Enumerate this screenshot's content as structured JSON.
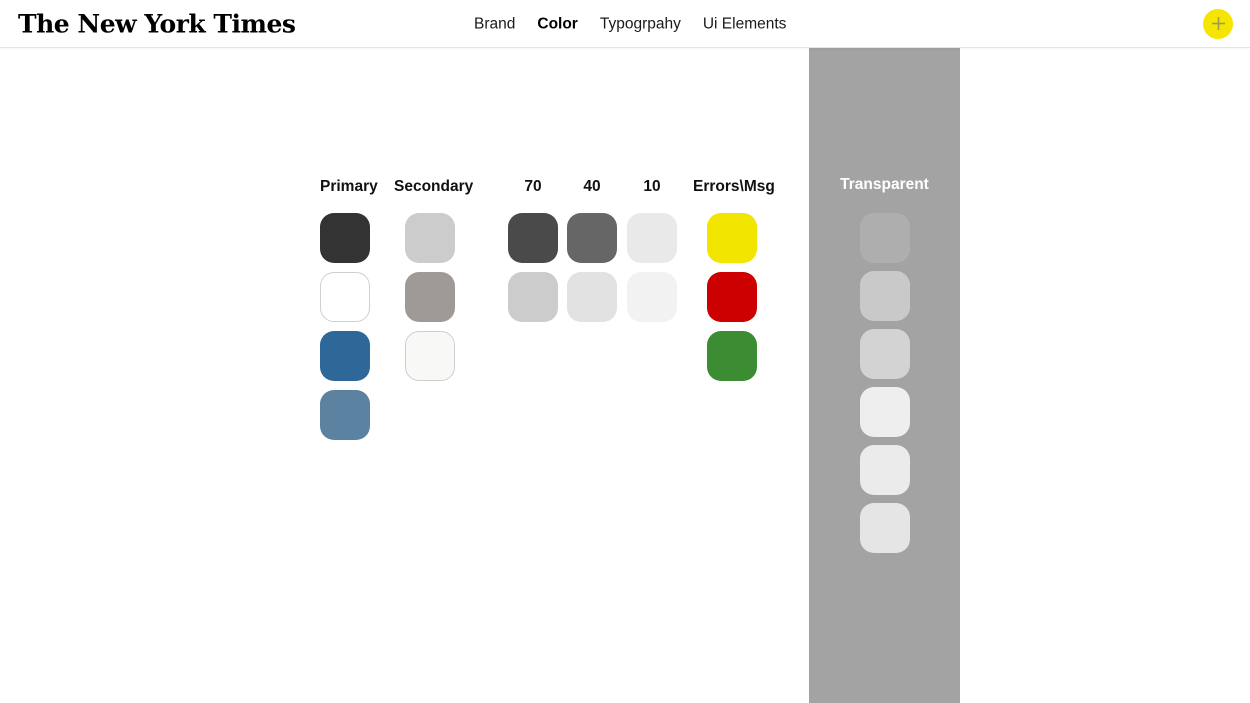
{
  "header": {
    "logo_text": "The New York Times",
    "nav": [
      {
        "label": "Brand",
        "active": false
      },
      {
        "label": "Color",
        "active": true
      },
      {
        "label": "Typogrpahy",
        "active": false
      },
      {
        "label": "Ui Elements",
        "active": false
      }
    ],
    "add_button": {
      "icon": "plus-icon",
      "background": "#f5e500",
      "icon_color": "#9b9b5a"
    }
  },
  "palette": {
    "columns": [
      {
        "header": "Primary",
        "swatches": [
          {
            "color": "#333333",
            "bordered": false
          },
          {
            "color": "#ffffff",
            "bordered": true
          },
          {
            "color": "#2d6898",
            "bordered": false
          },
          {
            "color": "#5b82a0",
            "bordered": false
          }
        ]
      },
      {
        "header": "Secondary",
        "swatches": [
          {
            "color": "#cccccc",
            "bordered": false
          },
          {
            "color": "#9e9a98",
            "bordered": false
          },
          {
            "color": "#f8f8f6",
            "bordered": true
          }
        ]
      },
      {
        "header": "70",
        "swatches": [
          {
            "color": "#4a4a4a",
            "bordered": false
          },
          {
            "color": "#cccccc",
            "bordered": false
          }
        ]
      },
      {
        "header": "40",
        "swatches": [
          {
            "color": "#666666",
            "bordered": false
          },
          {
            "color": "#e2e2e2",
            "bordered": false
          }
        ]
      },
      {
        "header": "10",
        "swatches": [
          {
            "color": "#e9e9e9",
            "bordered": false
          },
          {
            "color": "#f2f2f2",
            "bordered": false
          }
        ]
      },
      {
        "header": "Errors\\Msg",
        "swatches": [
          {
            "color": "#f2e500",
            "bordered": false
          },
          {
            "color": "#cc0000",
            "bordered": false
          },
          {
            "color": "#3c8c33",
            "bordered": false
          }
        ]
      }
    ]
  },
  "transparent": {
    "title": "Transparent",
    "panel_color": "#a3a3a3",
    "swatches": [
      {
        "color": "rgba(255,255,255,0.12)"
      },
      {
        "color": "rgba(255,255,255,0.42)"
      },
      {
        "color": "rgba(255,255,255,0.52)"
      },
      {
        "color": "rgba(255,255,255,0.82)"
      },
      {
        "color": "rgba(255,255,255,0.78)"
      },
      {
        "color": "rgba(255,255,255,0.72)"
      }
    ]
  }
}
